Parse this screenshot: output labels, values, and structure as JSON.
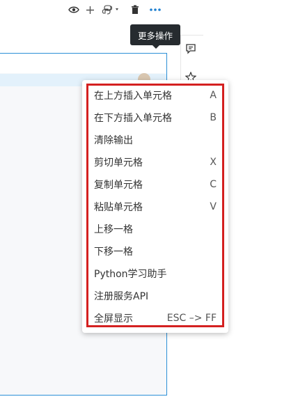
{
  "tooltip": {
    "text": "更多操作"
  },
  "toolbar": {
    "preview_icon": "eye-icon",
    "add_icon": "plus-icon",
    "python_icon": "python-logo-icon",
    "delete_icon": "trash-icon",
    "more_icon": "ellipsis-icon"
  },
  "side_panel": {
    "comment_icon": "comment-icon",
    "star_icon": "star-icon"
  },
  "menu": {
    "items": [
      {
        "label": "在上方插入单元格",
        "shortcut": "A"
      },
      {
        "label": "在下方插入单元格",
        "shortcut": "B"
      },
      {
        "label": "清除输出",
        "shortcut": ""
      },
      {
        "label": "剪切单元格",
        "shortcut": "X"
      },
      {
        "label": "复制单元格",
        "shortcut": "C"
      },
      {
        "label": "粘贴单元格",
        "shortcut": "V"
      },
      {
        "label": "上移一格",
        "shortcut": ""
      },
      {
        "label": "下移一格",
        "shortcut": ""
      },
      {
        "label": "Python学习助手",
        "shortcut": ""
      },
      {
        "label": "注册服务API",
        "shortcut": ""
      },
      {
        "label": "全屏显示",
        "shortcut": "ESC –> FF"
      }
    ]
  },
  "colors": {
    "accent": "#2b8fd6",
    "highlight_frame": "#d42020",
    "tooltip_bg": "#262b2f"
  }
}
